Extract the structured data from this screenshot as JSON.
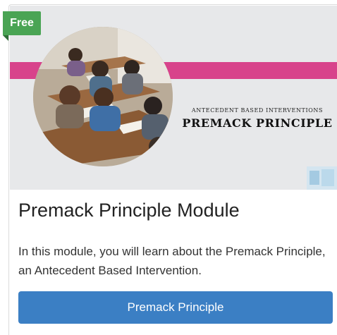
{
  "badge": {
    "label": "Free",
    "color": "#4aa454"
  },
  "hero": {
    "kicker": "ANTECEDENT BASED INTERVENTIONS",
    "title": "PREMACK PRINCIPLE",
    "stripe_color": "#d8438b",
    "photo_description_icon": "classroom-photo",
    "logo_icon": "brand-logo"
  },
  "module": {
    "title": "Premack Principle Module",
    "description": "In this module, you will learn about the Premack Principle, an Antecedent Based Intervention.",
    "button_label": "Premack Principle",
    "button_color": "#3b7fc4"
  }
}
